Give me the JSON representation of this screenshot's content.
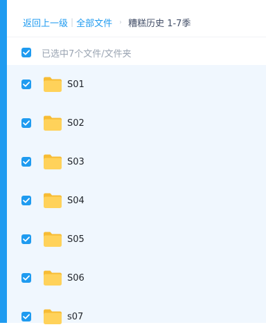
{
  "breadcrumb": {
    "back_label": "返回上一级",
    "separator": "|",
    "all_files_label": "全部文件",
    "arrow": "›",
    "current_folder": "糟糕历史 1-7季"
  },
  "selection": {
    "checked": true,
    "status_text": "已选中7个文件/文件夹"
  },
  "files": [
    {
      "name": "S01",
      "type": "folder",
      "checked": true
    },
    {
      "name": "S02",
      "type": "folder",
      "checked": true
    },
    {
      "name": "S03",
      "type": "folder",
      "checked": true
    },
    {
      "name": "S04",
      "type": "folder",
      "checked": true
    },
    {
      "name": "S05",
      "type": "folder",
      "checked": true
    },
    {
      "name": "S06",
      "type": "folder",
      "checked": true
    },
    {
      "name": "s07",
      "type": "folder",
      "checked": true
    }
  ],
  "colors": {
    "accent": "#1f9bf0",
    "selected_row_bg": "#f0f7fe",
    "folder_body": "#ffd25a",
    "folder_tab": "#f7bc34"
  },
  "icons": {
    "checkbox": "check-icon",
    "folder": "folder-icon",
    "breadcrumb_arrow": "chevron-right-icon"
  }
}
